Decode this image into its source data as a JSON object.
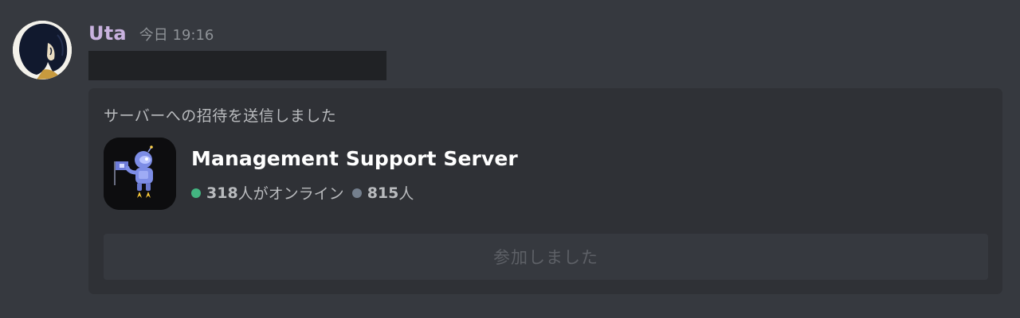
{
  "message": {
    "username": "Uta",
    "timestamp": "今日 19:16",
    "username_color": "#c9b2df"
  },
  "invite": {
    "heading": "サーバーへの招待を送信しました",
    "server_name": "Management Support Server",
    "online_count": "318",
    "online_label": "人がオンライン",
    "member_count": "815",
    "member_label": "人",
    "join_button_label": "参加しました",
    "online_color": "#43b581",
    "member_dot_color": "#747f8d"
  },
  "icons": {
    "avatar": "user-avatar",
    "server": "robot-astronaut-server-icon",
    "online": "online-status-dot-icon",
    "members": "member-status-dot-icon"
  }
}
